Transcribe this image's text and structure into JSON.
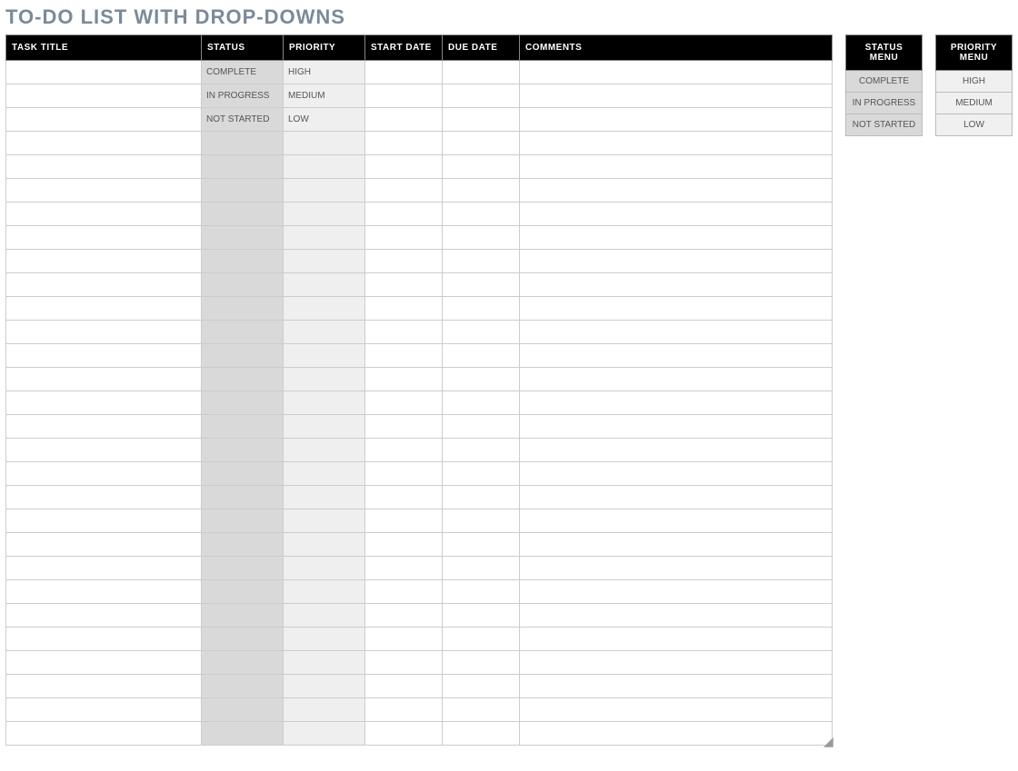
{
  "title": "TO-DO LIST WITH DROP-DOWNS",
  "columns": {
    "task_title": "TASK TITLE",
    "status": "STATUS",
    "priority": "PRIORITY",
    "start_date": "START DATE",
    "due_date": "DUE DATE",
    "comments": "COMMENTS"
  },
  "rows": [
    {
      "task": "",
      "status": "COMPLETE",
      "priority": "HIGH",
      "start": "",
      "due": "",
      "comments": ""
    },
    {
      "task": "",
      "status": "IN PROGRESS",
      "priority": "MEDIUM",
      "start": "",
      "due": "",
      "comments": ""
    },
    {
      "task": "",
      "status": "NOT STARTED",
      "priority": "LOW",
      "start": "",
      "due": "",
      "comments": ""
    },
    {
      "task": "",
      "status": "",
      "priority": "",
      "start": "",
      "due": "",
      "comments": ""
    },
    {
      "task": "",
      "status": "",
      "priority": "",
      "start": "",
      "due": "",
      "comments": ""
    },
    {
      "task": "",
      "status": "",
      "priority": "",
      "start": "",
      "due": "",
      "comments": ""
    },
    {
      "task": "",
      "status": "",
      "priority": "",
      "start": "",
      "due": "",
      "comments": ""
    },
    {
      "task": "",
      "status": "",
      "priority": "",
      "start": "",
      "due": "",
      "comments": ""
    },
    {
      "task": "",
      "status": "",
      "priority": "",
      "start": "",
      "due": "",
      "comments": ""
    },
    {
      "task": "",
      "status": "",
      "priority": "",
      "start": "",
      "due": "",
      "comments": ""
    },
    {
      "task": "",
      "status": "",
      "priority": "",
      "start": "",
      "due": "",
      "comments": ""
    },
    {
      "task": "",
      "status": "",
      "priority": "",
      "start": "",
      "due": "",
      "comments": ""
    },
    {
      "task": "",
      "status": "",
      "priority": "",
      "start": "",
      "due": "",
      "comments": ""
    },
    {
      "task": "",
      "status": "",
      "priority": "",
      "start": "",
      "due": "",
      "comments": ""
    },
    {
      "task": "",
      "status": "",
      "priority": "",
      "start": "",
      "due": "",
      "comments": ""
    },
    {
      "task": "",
      "status": "",
      "priority": "",
      "start": "",
      "due": "",
      "comments": ""
    },
    {
      "task": "",
      "status": "",
      "priority": "",
      "start": "",
      "due": "",
      "comments": ""
    },
    {
      "task": "",
      "status": "",
      "priority": "",
      "start": "",
      "due": "",
      "comments": ""
    },
    {
      "task": "",
      "status": "",
      "priority": "",
      "start": "",
      "due": "",
      "comments": ""
    },
    {
      "task": "",
      "status": "",
      "priority": "",
      "start": "",
      "due": "",
      "comments": ""
    },
    {
      "task": "",
      "status": "",
      "priority": "",
      "start": "",
      "due": "",
      "comments": ""
    },
    {
      "task": "",
      "status": "",
      "priority": "",
      "start": "",
      "due": "",
      "comments": ""
    },
    {
      "task": "",
      "status": "",
      "priority": "",
      "start": "",
      "due": "",
      "comments": ""
    },
    {
      "task": "",
      "status": "",
      "priority": "",
      "start": "",
      "due": "",
      "comments": ""
    },
    {
      "task": "",
      "status": "",
      "priority": "",
      "start": "",
      "due": "",
      "comments": ""
    },
    {
      "task": "",
      "status": "",
      "priority": "",
      "start": "",
      "due": "",
      "comments": ""
    },
    {
      "task": "",
      "status": "",
      "priority": "",
      "start": "",
      "due": "",
      "comments": ""
    },
    {
      "task": "",
      "status": "",
      "priority": "",
      "start": "",
      "due": "",
      "comments": ""
    },
    {
      "task": "",
      "status": "",
      "priority": "",
      "start": "",
      "due": "",
      "comments": ""
    }
  ],
  "status_menu": {
    "header": "STATUS MENU",
    "items": [
      "COMPLETE",
      "IN PROGRESS",
      "NOT STARTED"
    ]
  },
  "priority_menu": {
    "header": "PRIORITY MENU",
    "items": [
      "HIGH",
      "MEDIUM",
      "LOW"
    ]
  }
}
